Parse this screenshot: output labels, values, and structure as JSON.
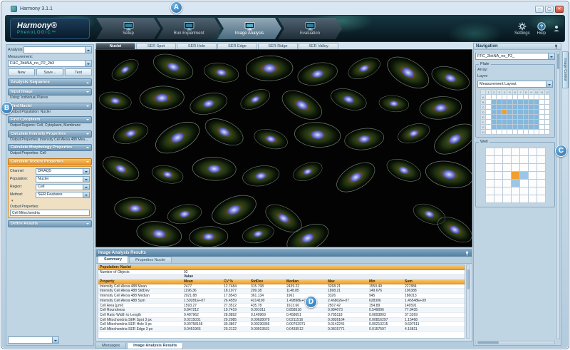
{
  "colors": {
    "accent_orange": "#f0a332",
    "header_blue": "#5d87ad",
    "annotation_blue": "#2f7ab8",
    "plate_fill_blue": "#85b8dc",
    "selection_orange": "#f0a030"
  },
  "window": {
    "title": "Harmony 3.1.1"
  },
  "annotations": {
    "a": "A",
    "b": "B",
    "c": "C",
    "d": "D"
  },
  "header": {
    "brand": "Harmony®",
    "brand_sub": "PhenoLOGIC™",
    "nav": [
      {
        "label": "Setup"
      },
      {
        "label": "Run Experiment"
      },
      {
        "label": "Image Analysis"
      },
      {
        "label": "Evaluation"
      }
    ],
    "active_nav": "Image Analysis",
    "settings_label": "Settings",
    "help_label": "Help"
  },
  "left_panel": {
    "analysis_label": "Analysis",
    "measurement_label": "Measurement:",
    "measurement_value": "FHC_2bkNA_no_P2_2b3",
    "buttons": {
      "new": "New",
      "save": "Save...",
      "test": "Test"
    },
    "sequence_title": "Analysis Sequence",
    "steps": [
      {
        "header": "Input Image",
        "lines": [
          "Using:  Individual Planes"
        ]
      },
      {
        "header": "Find Nuclei",
        "lines": [
          "Output Population:  Nuclei"
        ]
      },
      {
        "header": "Find Cytoplasm",
        "lines": [
          "Output Regions:  Cell, Cytoplasm, Membrane"
        ]
      },
      {
        "header": "Calculate Intensity Properties",
        "lines": [
          "Output Properties:  Intensity Cell Alexa 488 Mea..."
        ]
      },
      {
        "header": "Calculate Morphology Properties",
        "lines": [
          "Output Properties:  Cell"
        ]
      },
      {
        "header": "Calculate Texture Properties",
        "highlight": true,
        "fields": [
          {
            "label": "Channel:",
            "value": "DRAQ5"
          },
          {
            "label": "Population:",
            "value": "Nuclei"
          },
          {
            "label": "Region:",
            "value": "Cell"
          },
          {
            "label": "Method:",
            "value": "SER Features"
          }
        ],
        "output_label": "Output Properties:",
        "output_value": "Cell Mitochondria"
      },
      {
        "header": "Define Results",
        "lines": []
      }
    ]
  },
  "image_area": {
    "tabs": [
      "Nuclei",
      "SER Spot",
      "SER Hole",
      "SER Edge",
      "SER Ridge",
      "SER Valley"
    ],
    "active_tab": "Nuclei"
  },
  "results": {
    "title": "Image Analysis Results",
    "tabs": [
      "Summary",
      "Properties Nuclei"
    ],
    "active_tab": "Summary",
    "population_label": "Population: Nuclei",
    "number_label": "Number of Objects",
    "number_value": "92",
    "value_header": "Value",
    "columns": [
      "Property",
      "Mean",
      "CV %",
      "StdDev",
      "Median",
      "Max",
      "Min",
      "Sum"
    ],
    "rows": [
      [
        "Intensity Cell Alexa 488 Mean",
        "2477",
        "12.7484",
        "315.708",
        "2439.22",
        "3268.21",
        "1550.49",
        "227884"
      ],
      [
        "Intensity Cell Alexa 488 StdDev",
        "1196.36",
        "18.1077",
        "209.38",
        "1148.85",
        "1898.21",
        "149.676",
        "106388"
      ],
      [
        "Intensity Cell Alexa 488 Median",
        "2021.88",
        "17.8543",
        "361.134",
        "1961",
        "3326",
        "945",
        "186013"
      ],
      [
        "Intensity Cell Alexa 488 Sum",
        "1.59281E+07",
        "26.4559",
        "4214190",
        "1.49898E+07",
        "2.46802E+07",
        "628306",
        "1.46548E+09"
      ],
      [
        "Cell Area [µm²]",
        "1593.27",
        "27.3512",
        "435.78",
        "1613.66",
        "2507.42",
        "154.89",
        "146591"
      ],
      [
        "Cell Roundness",
        "0.847212",
        "10.7419",
        "0.091011",
        "0.858518",
        "0.984073",
        "0.549096",
        "77.9435"
      ],
      [
        "Cell Ratio Width to Length",
        "0.487962",
        "28.8892",
        "0.140969",
        "0.458651",
        "0.785118",
        "0.0893803",
        "37.5269"
      ],
      [
        "Cell Mitochondria SER Spot 3 px",
        "0.0215031",
        "29.2085",
        "0.00628079",
        "0.0211516",
        "0.0826164",
        "0.00816297",
        "1.15468"
      ],
      [
        "Cell Mitochondria SER Hole 3 px",
        "0.00758166",
        "30.3867",
        "0.00230366",
        "0.00762971",
        "0.0142241",
        "0.00213215",
        "0.697511"
      ],
      [
        "Cell Mitochondria SER Edge 3 px",
        "0.0451966",
        "20.2122",
        "0.00913531",
        "0.0433512",
        "0.0815771",
        "0.0157597",
        "4.15811"
      ]
    ]
  },
  "bottom_tabs": [
    "Messages",
    "Image Analysis Results"
  ],
  "navigation": {
    "title": "Navigation",
    "dropdown_value": "FFC_2bkNA_no_P2_",
    "plate_label": "Plate",
    "array_label": "Array:",
    "layer_label": "Layer:",
    "layer_value": "Measurement Layout",
    "well_label": "Well",
    "side_tab_label": "Image Control",
    "plate_grid": {
      "columns": 12,
      "rows": 8,
      "filled": {
        "col_start": 2,
        "col_end": 10,
        "row_start": 2,
        "row_end": 7
      },
      "selected": {
        "col": 4,
        "row": 4
      }
    },
    "well_grid": {
      "size": 7,
      "selected": [
        [
          3,
          3
        ],
        [
          4,
          3
        ],
        [
          3,
          4
        ]
      ],
      "highlight": [
        3,
        3
      ]
    }
  }
}
